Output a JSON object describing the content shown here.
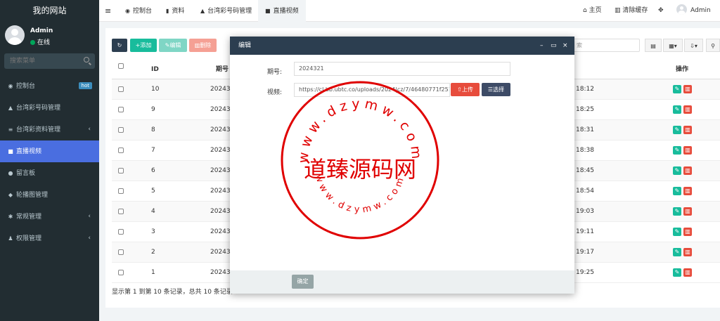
{
  "brand": "我的网站",
  "user": {
    "name": "Admin",
    "status": "在线"
  },
  "sidebar": {
    "search_placeholder": "搜索菜单",
    "items": [
      {
        "icon": "dashboard-icon",
        "glyph": "◉",
        "label": "控制台",
        "badge": "hot"
      },
      {
        "icon": "bell-icon",
        "glyph": "▲",
        "label": "台湾彩号码管理"
      },
      {
        "icon": "list-icon",
        "glyph": "≡",
        "label": "台湾彩资料管理",
        "chevron": "‹"
      },
      {
        "icon": "video-icon",
        "glyph": "■",
        "label": "直播视频",
        "active": true
      },
      {
        "icon": "comment-icon",
        "glyph": "●",
        "label": "留言板"
      },
      {
        "icon": "leaf-icon",
        "glyph": "◆",
        "label": "轮播图管理"
      },
      {
        "icon": "cogs-icon",
        "glyph": "✱",
        "label": "常规管理",
        "chevron": "‹"
      },
      {
        "icon": "users-icon",
        "glyph": "♟",
        "label": "权限管理",
        "chevron": "‹"
      }
    ]
  },
  "topnav": {
    "tabs": [
      {
        "icon": "dashboard-icon",
        "glyph": "◉",
        "label": "控制台"
      },
      {
        "icon": "bookmark-icon",
        "glyph": "▮",
        "label": "资料"
      },
      {
        "icon": "bell-icon",
        "glyph": "▲",
        "label": "台湾彩号码管理"
      },
      {
        "icon": "video-icon",
        "glyph": "■",
        "label": "直播视频",
        "active": true
      }
    ],
    "home": "主页",
    "clear_cache": "清除缓存",
    "user": "Admin"
  },
  "toolbar": {
    "add": "添加",
    "edit": "编辑",
    "delete": "删除",
    "search_placeholder": "索"
  },
  "table": {
    "headers": {
      "id": "ID",
      "period": "期号",
      "action": "操作"
    },
    "rows": [
      {
        "id": "10",
        "period": "202432",
        "time": "18:12"
      },
      {
        "id": "9",
        "period": "202432",
        "time": "18:25"
      },
      {
        "id": "8",
        "period": "202431",
        "time": "18:31"
      },
      {
        "id": "7",
        "period": "202431",
        "time": "18:38"
      },
      {
        "id": "6",
        "period": "202431",
        "time": "18:45"
      },
      {
        "id": "5",
        "period": "202431",
        "time": "18:54"
      },
      {
        "id": "4",
        "period": "202431",
        "time": "19:03"
      },
      {
        "id": "3",
        "period": "202431",
        "time": "19:11"
      },
      {
        "id": "2",
        "period": "202431",
        "time": "19:17"
      },
      {
        "id": "1",
        "period": "202431",
        "time": "19:25"
      }
    ]
  },
  "footer": "显示第 1 到第 10 条记录，总共 10 条记录",
  "modal": {
    "title": "编辑",
    "period_label": "期号:",
    "period_value": "2024321",
    "video_label": "视频:",
    "video_value": "https://cl.bb.ubtc.co/uploads/2024|cz/7/46480771f25145",
    "upload": "上传",
    "choose": "选择",
    "confirm": "确定"
  },
  "watermark": {
    "text": "道臻源码网",
    "url_top": "www.dzymw.com",
    "url_bottom": "www.dzymw.com",
    "color": "#e00000"
  }
}
